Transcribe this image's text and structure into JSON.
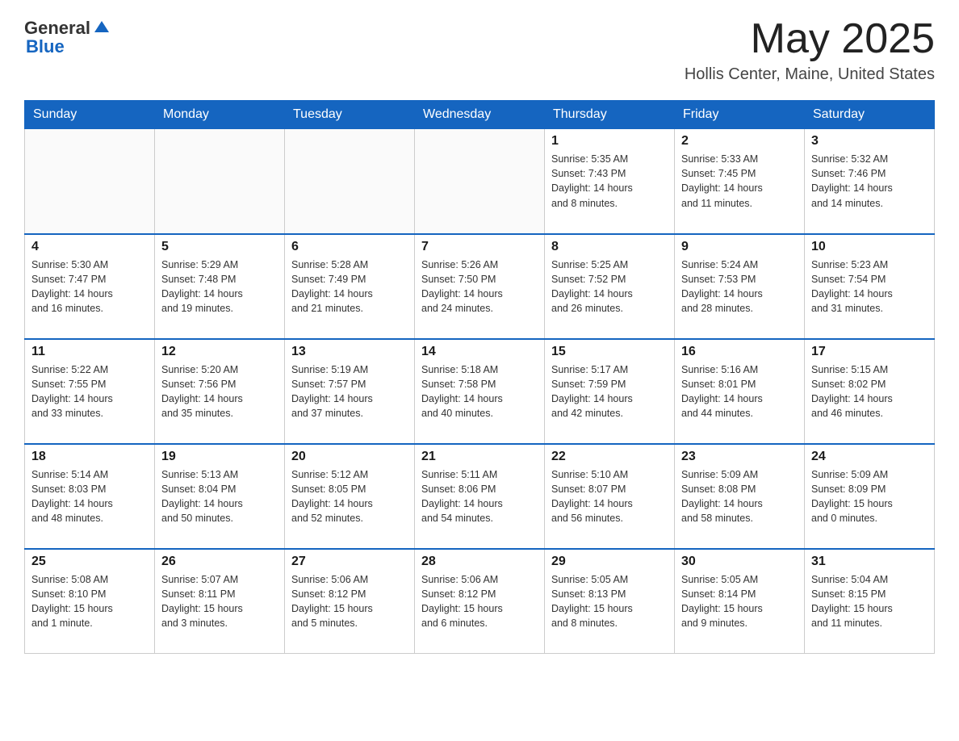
{
  "header": {
    "logo_general": "General",
    "logo_blue": "Blue",
    "month_title": "May 2025",
    "location": "Hollis Center, Maine, United States"
  },
  "days_of_week": [
    "Sunday",
    "Monday",
    "Tuesday",
    "Wednesday",
    "Thursday",
    "Friday",
    "Saturday"
  ],
  "weeks": [
    [
      {
        "day": "",
        "info": ""
      },
      {
        "day": "",
        "info": ""
      },
      {
        "day": "",
        "info": ""
      },
      {
        "day": "",
        "info": ""
      },
      {
        "day": "1",
        "info": "Sunrise: 5:35 AM\nSunset: 7:43 PM\nDaylight: 14 hours\nand 8 minutes."
      },
      {
        "day": "2",
        "info": "Sunrise: 5:33 AM\nSunset: 7:45 PM\nDaylight: 14 hours\nand 11 minutes."
      },
      {
        "day": "3",
        "info": "Sunrise: 5:32 AM\nSunset: 7:46 PM\nDaylight: 14 hours\nand 14 minutes."
      }
    ],
    [
      {
        "day": "4",
        "info": "Sunrise: 5:30 AM\nSunset: 7:47 PM\nDaylight: 14 hours\nand 16 minutes."
      },
      {
        "day": "5",
        "info": "Sunrise: 5:29 AM\nSunset: 7:48 PM\nDaylight: 14 hours\nand 19 minutes."
      },
      {
        "day": "6",
        "info": "Sunrise: 5:28 AM\nSunset: 7:49 PM\nDaylight: 14 hours\nand 21 minutes."
      },
      {
        "day": "7",
        "info": "Sunrise: 5:26 AM\nSunset: 7:50 PM\nDaylight: 14 hours\nand 24 minutes."
      },
      {
        "day": "8",
        "info": "Sunrise: 5:25 AM\nSunset: 7:52 PM\nDaylight: 14 hours\nand 26 minutes."
      },
      {
        "day": "9",
        "info": "Sunrise: 5:24 AM\nSunset: 7:53 PM\nDaylight: 14 hours\nand 28 minutes."
      },
      {
        "day": "10",
        "info": "Sunrise: 5:23 AM\nSunset: 7:54 PM\nDaylight: 14 hours\nand 31 minutes."
      }
    ],
    [
      {
        "day": "11",
        "info": "Sunrise: 5:22 AM\nSunset: 7:55 PM\nDaylight: 14 hours\nand 33 minutes."
      },
      {
        "day": "12",
        "info": "Sunrise: 5:20 AM\nSunset: 7:56 PM\nDaylight: 14 hours\nand 35 minutes."
      },
      {
        "day": "13",
        "info": "Sunrise: 5:19 AM\nSunset: 7:57 PM\nDaylight: 14 hours\nand 37 minutes."
      },
      {
        "day": "14",
        "info": "Sunrise: 5:18 AM\nSunset: 7:58 PM\nDaylight: 14 hours\nand 40 minutes."
      },
      {
        "day": "15",
        "info": "Sunrise: 5:17 AM\nSunset: 7:59 PM\nDaylight: 14 hours\nand 42 minutes."
      },
      {
        "day": "16",
        "info": "Sunrise: 5:16 AM\nSunset: 8:01 PM\nDaylight: 14 hours\nand 44 minutes."
      },
      {
        "day": "17",
        "info": "Sunrise: 5:15 AM\nSunset: 8:02 PM\nDaylight: 14 hours\nand 46 minutes."
      }
    ],
    [
      {
        "day": "18",
        "info": "Sunrise: 5:14 AM\nSunset: 8:03 PM\nDaylight: 14 hours\nand 48 minutes."
      },
      {
        "day": "19",
        "info": "Sunrise: 5:13 AM\nSunset: 8:04 PM\nDaylight: 14 hours\nand 50 minutes."
      },
      {
        "day": "20",
        "info": "Sunrise: 5:12 AM\nSunset: 8:05 PM\nDaylight: 14 hours\nand 52 minutes."
      },
      {
        "day": "21",
        "info": "Sunrise: 5:11 AM\nSunset: 8:06 PM\nDaylight: 14 hours\nand 54 minutes."
      },
      {
        "day": "22",
        "info": "Sunrise: 5:10 AM\nSunset: 8:07 PM\nDaylight: 14 hours\nand 56 minutes."
      },
      {
        "day": "23",
        "info": "Sunrise: 5:09 AM\nSunset: 8:08 PM\nDaylight: 14 hours\nand 58 minutes."
      },
      {
        "day": "24",
        "info": "Sunrise: 5:09 AM\nSunset: 8:09 PM\nDaylight: 15 hours\nand 0 minutes."
      }
    ],
    [
      {
        "day": "25",
        "info": "Sunrise: 5:08 AM\nSunset: 8:10 PM\nDaylight: 15 hours\nand 1 minute."
      },
      {
        "day": "26",
        "info": "Sunrise: 5:07 AM\nSunset: 8:11 PM\nDaylight: 15 hours\nand 3 minutes."
      },
      {
        "day": "27",
        "info": "Sunrise: 5:06 AM\nSunset: 8:12 PM\nDaylight: 15 hours\nand 5 minutes."
      },
      {
        "day": "28",
        "info": "Sunrise: 5:06 AM\nSunset: 8:12 PM\nDaylight: 15 hours\nand 6 minutes."
      },
      {
        "day": "29",
        "info": "Sunrise: 5:05 AM\nSunset: 8:13 PM\nDaylight: 15 hours\nand 8 minutes."
      },
      {
        "day": "30",
        "info": "Sunrise: 5:05 AM\nSunset: 8:14 PM\nDaylight: 15 hours\nand 9 minutes."
      },
      {
        "day": "31",
        "info": "Sunrise: 5:04 AM\nSunset: 8:15 PM\nDaylight: 15 hours\nand 11 minutes."
      }
    ]
  ]
}
